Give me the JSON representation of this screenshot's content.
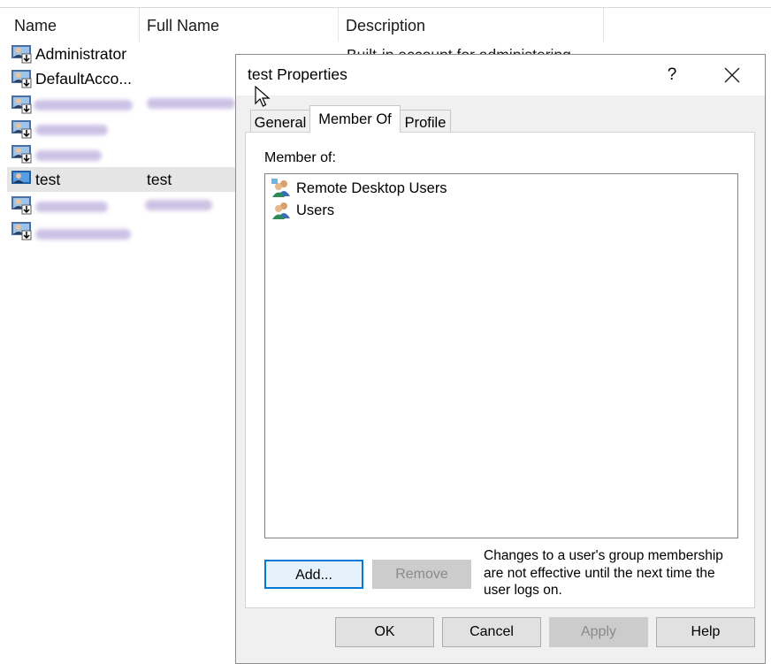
{
  "listview": {
    "columns": [
      "Name",
      "Full Name",
      "Description"
    ],
    "description_partial": "Built-in account for administering",
    "rows": [
      {
        "name": "Administrator",
        "full_name": ""
      },
      {
        "name": "DefaultAcco...",
        "full_name": ""
      },
      {
        "name": "",
        "full_name": ""
      },
      {
        "name": "",
        "full_name": ""
      },
      {
        "name": "",
        "full_name": ""
      },
      {
        "name": "test",
        "full_name": "test"
      },
      {
        "name": "",
        "full_name": ""
      },
      {
        "name": "",
        "full_name": ""
      }
    ]
  },
  "dialog": {
    "title": "test Properties",
    "help_glyph": "?",
    "tabs": [
      "General",
      "Member Of",
      "Profile"
    ],
    "member_of_label": "Member of:",
    "groups": [
      "Remote Desktop Users",
      "Users"
    ],
    "add_label": "Add...",
    "remove_label": "Remove",
    "note": "Changes to a user's group membership are not effective until the next time the user logs on.",
    "buttons": {
      "ok": "OK",
      "cancel": "Cancel",
      "apply": "Apply",
      "help": "Help"
    }
  },
  "icons": [
    "user-icon",
    "group-icon",
    "close-icon",
    "cursor-icon"
  ]
}
